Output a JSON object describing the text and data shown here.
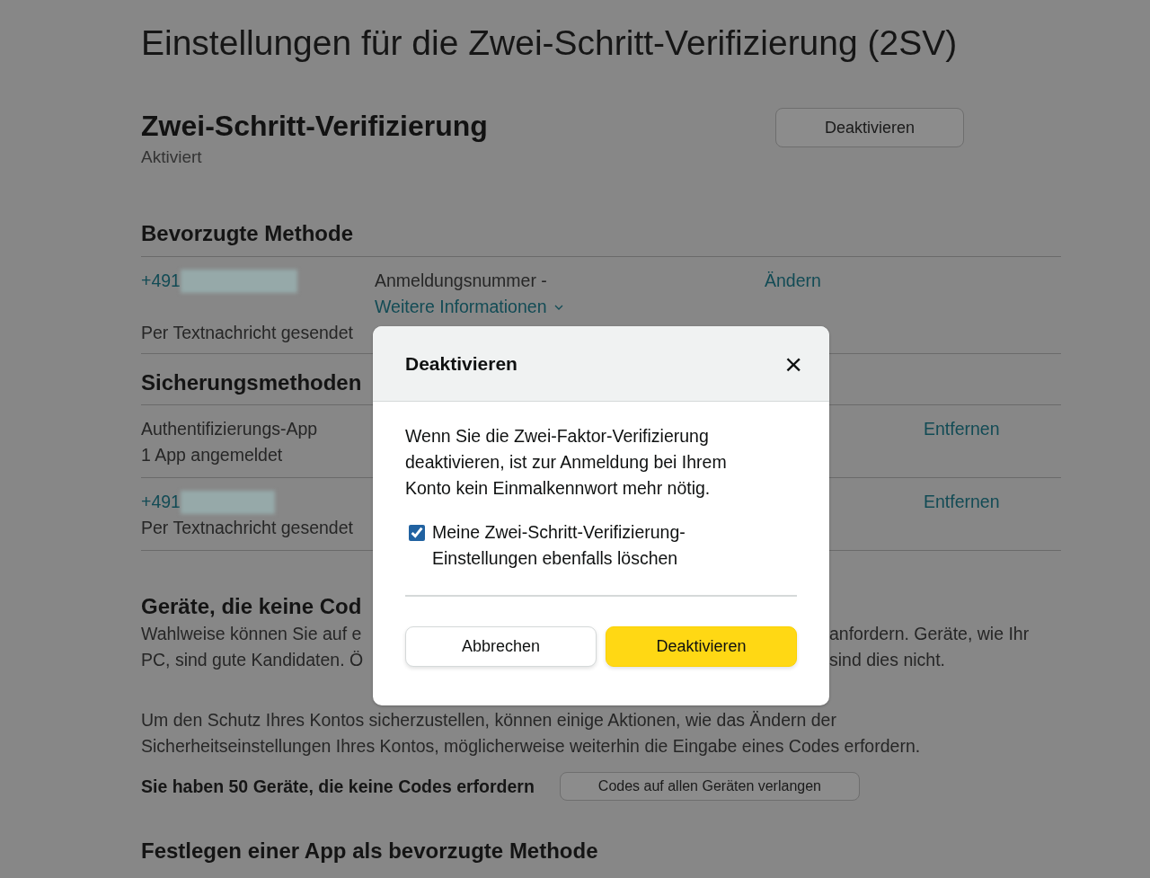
{
  "page_title": "Einstellungen für die Zwei-Schritt-Verifizierung (2SV)",
  "status_section": {
    "title": "Zwei-Schritt-Verifizierung",
    "status": "Aktiviert",
    "button": "Deaktivieren"
  },
  "preferred_method": {
    "heading": "Bevorzugte Methode",
    "phone_prefix": "+491",
    "description": "Anmeldungsnummer -",
    "link": "Weitere Informationen",
    "action": "Ändern",
    "delivery": "Per Textnachricht gesendet"
  },
  "backup_methods": {
    "heading": "Sicherungsmethoden",
    "items": [
      {
        "kind": "app",
        "title": "Authentifizierungs-App",
        "subtitle": "1 App angemeldet",
        "action": "Entfernen"
      },
      {
        "kind": "phone",
        "title": "+491",
        "subtitle": "Per Textnachricht gesendet",
        "action": "Entfernen"
      }
    ]
  },
  "devices": {
    "heading": "Geräte, die keine Cod",
    "lines": [
      {
        "left": "Wahlweise können Sie auf e",
        "right": "anfordern. Geräte, wie Ihr"
      },
      {
        "left": "PC, sind gute Kandidaten. Ö",
        "right": "sind dies nicht."
      }
    ],
    "notice": "Um den Schutz Ihres Kontos sicherzustellen, können einige Aktionen, wie das Ändern der Sicherheitseinstellungen Ihres Kontos, möglicherweise weiterhin die Eingabe eines Codes erfordern.",
    "summary": "Sie haben 50 Geräte, die keine Codes erfordern",
    "button": "Codes auf allen Geräten verlangen"
  },
  "next_heading": "Festlegen einer App als bevorzugte Methode",
  "dialog": {
    "title": "Deaktivieren",
    "close": "×",
    "body": "Wenn Sie die Zwei-Faktor-Verifizierung deaktivieren, ist zur Anmeldung bei Ihrem Konto kein Einmalkennwort mehr nötig.",
    "checkbox": {
      "label": "Meine Zwei-Schritt-Verifizierung-Einstellungen ebenfalls löschen",
      "checked": true
    },
    "buttons": [
      {
        "label": "Abbrechen",
        "kind": "secondary"
      },
      {
        "label": "Deaktivieren",
        "kind": "primary"
      }
    ]
  }
}
